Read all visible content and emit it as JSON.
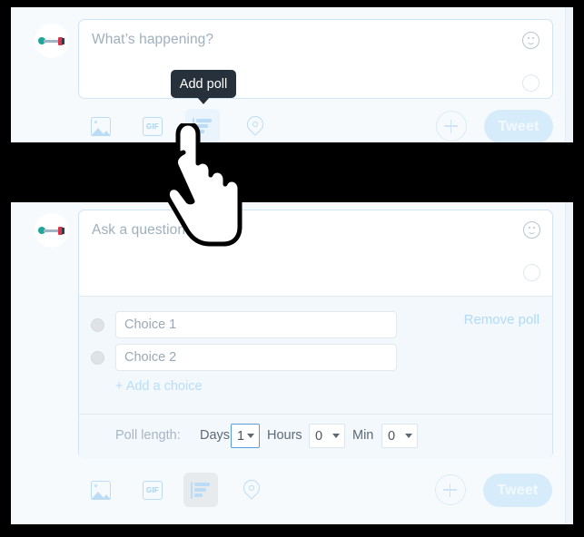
{
  "app": {
    "name": "twitter-compose-poll",
    "accent_blue": "#bcdcf6",
    "tweet_button_bg": "#d7ecfb",
    "tooltip_bg": "#26313b",
    "panel_bg": "#f6fafd",
    "poll_section_bg": "#f3f8fc",
    "focus_border": "#5b9ee0",
    "backdrop": "#000000"
  },
  "top_panel": {
    "avatar_label": "user-avatar",
    "composer": {
      "placeholder": "What’s happening?",
      "emoji_icon": "smiley-icon",
      "char_counter_icon": "character-count-circle"
    },
    "tooltip": {
      "label": "Add poll"
    },
    "toolbar": {
      "items": [
        {
          "name": "add-photo",
          "icon": "image-icon",
          "label": ""
        },
        {
          "name": "add-gif",
          "icon": "gif-icon",
          "label": "GIF"
        },
        {
          "name": "add-poll",
          "icon": "poll-icon",
          "label": "",
          "state": "hover"
        },
        {
          "name": "add-location",
          "icon": "location-pin-icon",
          "label": ""
        }
      ],
      "plus_label": "+",
      "tweet_label": "Tweet"
    }
  },
  "bottom_panel": {
    "avatar_label": "user-avatar",
    "composer": {
      "placeholder": "Ask a question...",
      "emoji_icon": "smiley-icon",
      "char_counter_icon": "character-count-circle"
    },
    "poll": {
      "choices": [
        {
          "placeholder": "Choice 1"
        },
        {
          "placeholder": "Choice 2"
        }
      ],
      "add_choice_label": "+ Add a choice",
      "remove_poll_label": "Remove poll",
      "length_label": "Poll length:",
      "days_label": "Days",
      "days_value": "1",
      "hours_label": "Hours",
      "hours_value": "0",
      "min_label": "Min",
      "min_value": "0"
    },
    "toolbar": {
      "items": [
        {
          "name": "add-photo",
          "icon": "image-icon",
          "label": ""
        },
        {
          "name": "add-gif",
          "icon": "gif-icon",
          "label": "GIF"
        },
        {
          "name": "add-poll",
          "icon": "poll-icon",
          "label": "",
          "state": "active"
        },
        {
          "name": "add-location",
          "icon": "location-pin-icon",
          "label": ""
        }
      ],
      "plus_label": "+",
      "tweet_label": "Tweet"
    }
  },
  "cursor": {
    "type": "pointing-hand-cursor"
  }
}
